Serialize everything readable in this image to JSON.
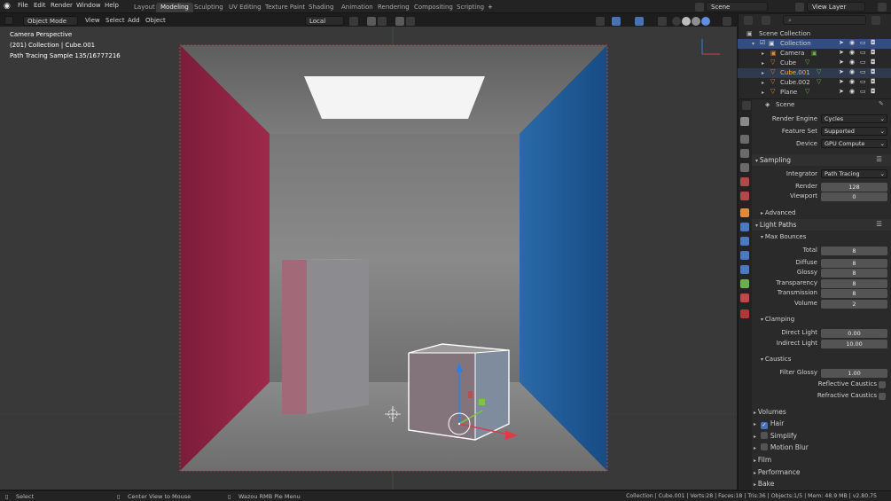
{
  "menubar": {
    "file": "File",
    "edit": "Edit",
    "render": "Render",
    "window": "Window",
    "help": "Help"
  },
  "workspaces": [
    "Layout",
    "Modeling",
    "Sculpting",
    "UV Editing",
    "Texture Paint",
    "Shading",
    "Animation",
    "Rendering",
    "Compositing",
    "Scripting"
  ],
  "active_workspace": "Modeling",
  "scene_field": "Scene",
  "view_layer_field": "View Layer",
  "header": {
    "mode": "Object Mode",
    "view": "View",
    "select": "Select",
    "add": "Add",
    "object": "Object",
    "orientation": "Local"
  },
  "overlay": {
    "line1": "Camera Perspective",
    "line2": "(201) Collection | Cube.001",
    "line3": "Path Tracing Sample 135/16777216"
  },
  "outliner": {
    "root": "Scene Collection",
    "items": [
      {
        "name": "Collection",
        "color": "#e0e0e0"
      },
      {
        "name": "Camera",
        "color": "#d8d8d8"
      },
      {
        "name": "Cube",
        "color": "#d8d8d8"
      },
      {
        "name": "Cube.001",
        "color": "#ffaf29"
      },
      {
        "name": "Cube.002",
        "color": "#d8d8d8"
      },
      {
        "name": "Plane",
        "color": "#d8d8d8"
      }
    ]
  },
  "props": {
    "context": "Scene",
    "render_engine_label": "Render Engine",
    "render_engine": "Cycles",
    "feature_set_label": "Feature Set",
    "feature_set": "Supported",
    "device_label": "Device",
    "device": "GPU Compute",
    "sampling": "Sampling",
    "integrator_label": "Integrator",
    "integrator": "Path Tracing",
    "render_label": "Render",
    "render_samples": "128",
    "viewport_label": "Viewport",
    "viewport_samples": "0",
    "advanced": "Advanced",
    "light_paths": "Light Paths",
    "max_bounces": "Max Bounces",
    "total_label": "Total",
    "total": "8",
    "diffuse_label": "Diffuse",
    "diffuse": "8",
    "glossy_label": "Glossy",
    "glossy": "8",
    "transparency_label": "Transparency",
    "transparency": "8",
    "transmission_label": "Transmission",
    "transmission": "8",
    "volume_label": "Volume",
    "volume": "2",
    "clamping": "Clamping",
    "direct_label": "Direct Light",
    "direct": "0.00",
    "indirect_label": "Indirect Light",
    "indirect": "10.00",
    "caustics": "Caustics",
    "filter_label": "Filter Glossy",
    "filter": "1.00",
    "reflective": "Reflective Caustics",
    "refractive": "Refractive Caustics",
    "volumes": "Volumes",
    "hair": "Hair",
    "simplify": "Simplify",
    "motion_blur": "Motion Blur",
    "film": "Film",
    "performance": "Performance",
    "bake": "Bake"
  },
  "status": {
    "select": "Select",
    "center": "Center View to Mouse",
    "pie": "Wazou RMB Pie Menu",
    "info": "Collection | Cube.001 | Verts:28 | Faces:18 | Tris:36 | Objects:1/5 | Mem: 48.9 MB | v2.80.75"
  },
  "colors": {
    "accent": "#4772b3",
    "active_object": "#ffaf29",
    "wall_left": "#8a1f3d",
    "wall_right": "#1e5690"
  }
}
